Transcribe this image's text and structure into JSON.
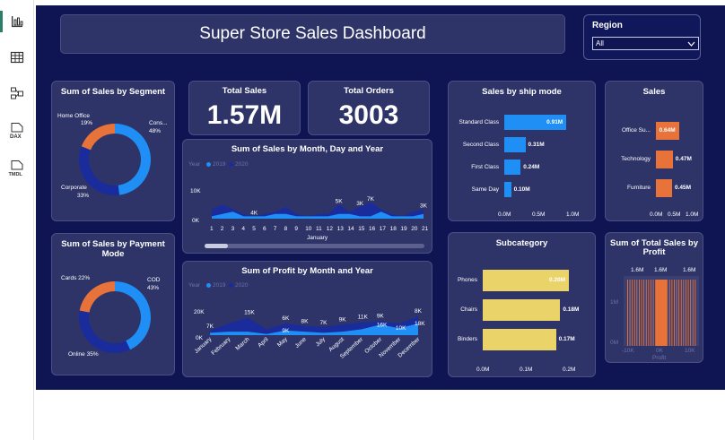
{
  "header": {
    "title": "Super Store Sales Dashboard"
  },
  "region_filter": {
    "label": "Region",
    "selected": "All"
  },
  "kpis": {
    "total_sales": {
      "label": "Total Sales",
      "value": "1.57M"
    },
    "total_orders": {
      "label": "Total Orders",
      "value": "3003"
    }
  },
  "segment_chart": {
    "title": "Sum of Sales by Segment",
    "slices": [
      {
        "name": "Cons...",
        "pct": "48%",
        "value": 48,
        "color": "#1f8ff5"
      },
      {
        "name": "Corporate",
        "pct": "33%",
        "value": 33,
        "color": "#1a2c9c"
      },
      {
        "name": "Home Office",
        "pct": "19%",
        "value": 19,
        "color": "#e8733a"
      }
    ]
  },
  "payment_chart": {
    "title_line1": "Sum of Sales by Payment",
    "title_line2": "Mode",
    "slices": [
      {
        "name": "COD",
        "pct": "43%",
        "value": 43,
        "color": "#1f8ff5"
      },
      {
        "name": "Online",
        "pct": "35%",
        "value": 35,
        "color": "#1a2c9c"
      },
      {
        "name": "Cards",
        "pct": "22%",
        "value": 22,
        "color": "#e8733a"
      }
    ],
    "labels": {
      "cod": "COD",
      "cod_pct": "43%",
      "online": "Online 35%",
      "cards": "Cards 22%"
    }
  },
  "sales_by_day": {
    "title": "Sum of Sales by Month, Day and Year",
    "legend_title": "Year",
    "legend": [
      "2019",
      "2020"
    ],
    "yticks": [
      "10K",
      "0K"
    ],
    "xticks": [
      "1",
      "2",
      "3",
      "4",
      "5",
      "6",
      "7",
      "8",
      "9",
      "10",
      "11",
      "12",
      "13",
      "14",
      "15",
      "16",
      "17",
      "18",
      "19",
      "20",
      "21"
    ],
    "xlabel": "January",
    "annotations": [
      "4K",
      "5K",
      "3K",
      "7K",
      "3K"
    ]
  },
  "profit_by_month": {
    "title": "Sum of Profit by Month and Year",
    "legend_title": "Year",
    "legend": [
      "2019",
      "2020"
    ],
    "yticks": [
      "20K",
      "0K"
    ],
    "months": [
      "January",
      "February",
      "March",
      "April",
      "May",
      "June",
      "July",
      "August",
      "September",
      "October",
      "November",
      "December"
    ],
    "annotations_top": [
      "7K",
      "15K",
      "6K",
      "8K",
      "7K",
      "9K",
      "11K",
      "9K",
      "8K"
    ],
    "annotations_bottom": [
      "9K",
      "16K",
      "10K",
      "18K"
    ]
  },
  "ship_mode": {
    "title": "Sales by ship mode",
    "categories": [
      "Standard Class",
      "Second Class",
      "First Class",
      "Same Day"
    ],
    "values": [
      0.91,
      0.31,
      0.24,
      0.1
    ],
    "labels": [
      "0.91M",
      "0.31M",
      "0.24M",
      "0.10M"
    ],
    "xticks": [
      "0.0M",
      "0.5M",
      "1.0M"
    ],
    "xmax": 1.0,
    "color": "#1f8ff5"
  },
  "sales_category": {
    "title": "Sales",
    "categories": [
      "Office Su...",
      "Technology",
      "Furniture"
    ],
    "values": [
      0.64,
      0.47,
      0.45
    ],
    "labels": [
      "0.64M",
      "0.47M",
      "0.45M"
    ],
    "xticks": [
      "0.0M",
      "0.5M",
      "1.0M"
    ],
    "xmax": 1.0,
    "color": "#e8733a"
  },
  "subcategory": {
    "title": "Subcategory",
    "categories": [
      "Phones",
      "Chairs",
      "Binders"
    ],
    "values": [
      0.2,
      0.18,
      0.17
    ],
    "labels": [
      "0.20M",
      "0.18M",
      "0.17M"
    ],
    "xticks": [
      "0.0M",
      "0.1M",
      "0.2M"
    ],
    "xmax": 0.2,
    "color": "#ead46a"
  },
  "profit_total": {
    "title_line1": "Sum of Total Sales by",
    "title_line2": "Profit",
    "top_labels": [
      "1.6M",
      "1.6M",
      "1.6M"
    ],
    "yticks": [
      "1M",
      "0M"
    ],
    "xticks": [
      "-10K",
      "0K",
      "10K"
    ],
    "xlabel": "Profit"
  },
  "colors": {
    "background": "#0f1553",
    "card": "#2e3468",
    "accent_blue": "#1f8ff5",
    "navy": "#1a2c9c",
    "orange": "#e8733a",
    "yellow": "#ead46a"
  }
}
